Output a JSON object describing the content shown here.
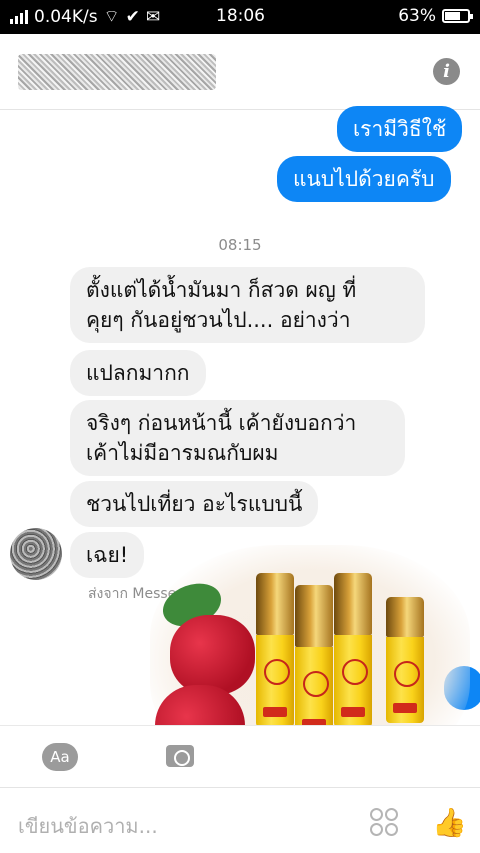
{
  "status_bar": {
    "speed": "0.04K/s",
    "time": "18:06",
    "battery": "63%",
    "battery_level": 0.63
  },
  "header": {
    "contact_name": "",
    "info_icon": "info-icon",
    "info_glyph": "i"
  },
  "messages": {
    "out1": "เรามีวิธีใช้",
    "out2": "แนบไปด้วยครับ",
    "timestamp": "08:15",
    "in1_line1": "ตั้งแต่ได้น้ำมันมา ก็สวด ผญ ที่",
    "in1_line2": "คุยๆ กันอยู่ชวนไป.... อย่างว่า",
    "in2": "แปลกมากก",
    "in3_line1": "จริงๆ ก่อนหน้านี้ เค้ายังบอกว่า",
    "in3_line2": "เค้าไม่มีอารมณกับผม",
    "in4": "ชวนไปเที่ยว อะไรแบบนี้",
    "in5": "เฉย!",
    "sent_from": "ส่งจาก Messenger"
  },
  "toolbar": {
    "aa_label": "Aa",
    "camera_icon": "camera-icon"
  },
  "composer": {
    "placeholder": "เขียนข้อความ...",
    "like_glyph": "👍",
    "emoji_icon": "emoji-icon"
  },
  "colors": {
    "outgoing": "#0d86f5",
    "incoming": "#f0f0f0"
  }
}
